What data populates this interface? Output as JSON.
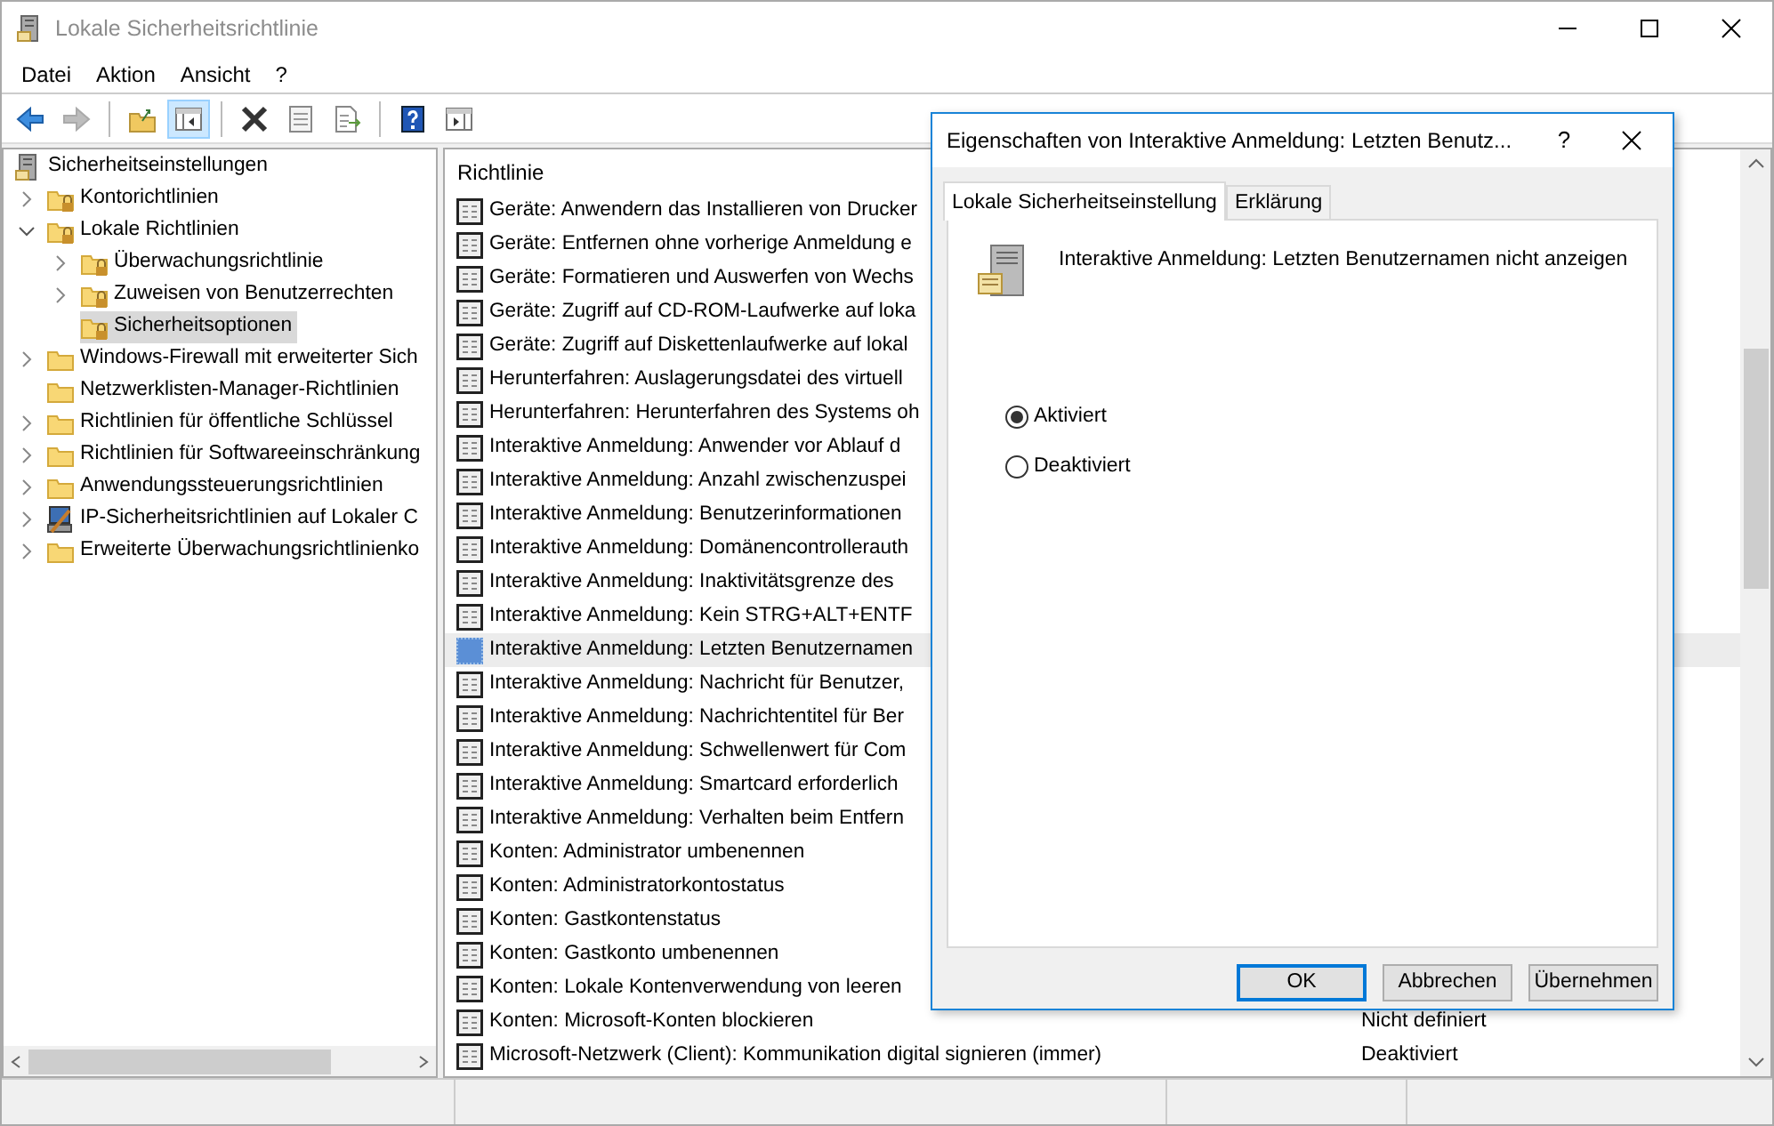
{
  "window": {
    "title": "Lokale Sicherheitsrichtlinie"
  },
  "menu": [
    "Datei",
    "Aktion",
    "Ansicht",
    "?"
  ],
  "toolbar": [
    {
      "kind": "back",
      "disabled": false
    },
    {
      "kind": "forward",
      "disabled": true
    },
    {
      "kind": "separator"
    },
    {
      "kind": "up",
      "disabled": false
    },
    {
      "kind": "tree",
      "pressed": true
    },
    {
      "kind": "separator"
    },
    {
      "kind": "delete",
      "disabled": false
    },
    {
      "kind": "properties",
      "disabled": false
    },
    {
      "kind": "export",
      "disabled": false
    },
    {
      "kind": "separator"
    },
    {
      "kind": "help",
      "disabled": false
    },
    {
      "kind": "actionpane",
      "pressed": false
    }
  ],
  "tree": [
    {
      "label": "Sicherheitseinstellungen",
      "kind": "server",
      "selected": false,
      "children": [
        {
          "label": "Kontorichtlinien",
          "kind": "locked-folder",
          "expanded": false,
          "selected": false
        },
        {
          "label": "Lokale Richtlinien",
          "kind": "locked-folder",
          "expanded": true,
          "selected": false,
          "children": [
            {
              "label": "Überwachungsrichtlinie",
              "kind": "locked-folder",
              "expanded": false,
              "selected": false
            },
            {
              "label": "Zuweisen von Benutzerrechten",
              "kind": "locked-folder",
              "expanded": false,
              "selected": false
            },
            {
              "label": "Sicherheitsoptionen",
              "kind": "locked-folder",
              "selected": true
            }
          ]
        },
        {
          "label": "Windows-Firewall mit erweiterter Sich",
          "kind": "folder",
          "expanded": false,
          "selected": false
        },
        {
          "label": "Netzwerklisten-Manager-Richtlinien",
          "kind": "folder",
          "selected": false
        },
        {
          "label": "Richtlinien für öffentliche Schlüssel",
          "kind": "folder",
          "expanded": false,
          "selected": false
        },
        {
          "label": "Richtlinien für Softwareeinschränkung",
          "kind": "folder",
          "expanded": false,
          "selected": false
        },
        {
          "label": "Anwendungssteuerungsrichtlinien",
          "kind": "folder",
          "expanded": false,
          "selected": false
        },
        {
          "label": "IP-Sicherheitsrichtlinien auf Lokaler C",
          "kind": "computer",
          "expanded": false,
          "selected": false
        },
        {
          "label": "Erweiterte Überwachungsrichtlinienko",
          "kind": "folder",
          "expanded": false,
          "selected": false
        }
      ]
    }
  ],
  "list": {
    "columns": [
      "Richtlinie"
    ],
    "rows": [
      {
        "policy": "Geräte: Anwendern das Installieren von Drucker",
        "selected": false
      },
      {
        "policy": "Geräte: Entfernen ohne vorherige Anmeldung e",
        "selected": false
      },
      {
        "policy": "Geräte: Formatieren und Auswerfen von Wechs",
        "selected": false
      },
      {
        "policy": "Geräte: Zugriff auf CD-ROM-Laufwerke auf loka",
        "selected": false
      },
      {
        "policy": "Geräte: Zugriff auf Diskettenlaufwerke auf lokal",
        "selected": false
      },
      {
        "policy": "Herunterfahren: Auslagerungsdatei des virtuell",
        "selected": false
      },
      {
        "policy": "Herunterfahren: Herunterfahren des Systems oh",
        "selected": false
      },
      {
        "policy": "Interaktive Anmeldung: Anwender vor Ablauf d",
        "selected": false
      },
      {
        "policy": "Interaktive Anmeldung: Anzahl zwischenzuspei",
        "selected": false
      },
      {
        "policy": "Interaktive Anmeldung: Benutzerinformationen",
        "selected": false
      },
      {
        "policy": "Interaktive Anmeldung: Domänencontrollerauth",
        "selected": false
      },
      {
        "policy": "Interaktive Anmeldung: Inaktivitätsgrenze des",
        "selected": false
      },
      {
        "policy": "Interaktive Anmeldung: Kein STRG+ALT+ENTF",
        "selected": false
      },
      {
        "policy": "Interaktive Anmeldung: Letzten Benutzernamen",
        "selected": true
      },
      {
        "policy": "Interaktive Anmeldung: Nachricht für Benutzer,",
        "selected": false
      },
      {
        "policy": "Interaktive Anmeldung: Nachrichtentitel für Ber",
        "selected": false
      },
      {
        "policy": "Interaktive Anmeldung: Schwellenwert für Com",
        "selected": false
      },
      {
        "policy": "Interaktive Anmeldung: Smartcard erforderlich",
        "selected": false
      },
      {
        "policy": "Interaktive Anmeldung: Verhalten beim Entfern",
        "selected": false
      },
      {
        "policy": "Konten: Administrator umbenennen",
        "selected": false
      },
      {
        "policy": "Konten: Administratorkontostatus",
        "selected": false
      },
      {
        "policy": "Konten: Gastkontenstatus",
        "selected": false
      },
      {
        "policy": "Konten: Gastkonto umbenennen",
        "selected": false
      },
      {
        "policy": "Konten: Lokale Kontenverwendung von leeren",
        "selected": false
      },
      {
        "policy": "Konten: Microsoft-Konten blockieren",
        "setting": "Nicht definiert",
        "selected": false
      },
      {
        "policy": "Microsoft-Netzwerk (Client): Kommunikation digital signieren (immer)",
        "setting": "Deaktiviert",
        "selected": false
      }
    ]
  },
  "dialog": {
    "title": "Eigenschaften von Interaktive Anmeldung: Letzten Benutz...",
    "help": "?",
    "tabs": [
      {
        "label": "Lokale Sicherheitseinstellung",
        "selected": true
      },
      {
        "label": "Erklärung",
        "selected": false
      }
    ],
    "policy": "Interaktive Anmeldung: Letzten Benutzernamen nicht anzeigen",
    "options": [
      {
        "label": "Aktiviert",
        "checked": true
      },
      {
        "label": "Deaktiviert",
        "checked": false
      }
    ],
    "buttons": [
      {
        "label": "OK",
        "default": true
      },
      {
        "label": "Abbrechen",
        "default": false
      },
      {
        "label": "Übernehmen",
        "default": false
      }
    ]
  }
}
